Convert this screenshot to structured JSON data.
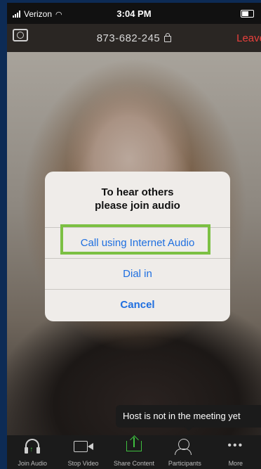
{
  "status_bar": {
    "carrier": "Verizon",
    "time": "3:04 PM"
  },
  "meeting": {
    "id": "873-682-245",
    "leave_label": "Leave"
  },
  "dialog": {
    "title_line1": "To hear others",
    "title_line2": "please join audio",
    "option_internet": "Call using Internet Audio",
    "option_dial": "Dial in",
    "option_cancel": "Cancel"
  },
  "toast": {
    "message": "Host is not in the meeting yet"
  },
  "toolbar": {
    "items": [
      {
        "label": "Join Audio",
        "icon": "headphones-icon"
      },
      {
        "label": "Stop Video",
        "icon": "video-camera-icon"
      },
      {
        "label": "Share Content",
        "icon": "share-icon"
      },
      {
        "label": "Participants",
        "icon": "participants-icon"
      },
      {
        "label": "More",
        "icon": "more-dots-icon"
      }
    ]
  },
  "colors": {
    "leave": "#e8403c",
    "link": "#1f6fe0",
    "highlight": "#7cc043",
    "share_green": "#3fbf3f"
  }
}
